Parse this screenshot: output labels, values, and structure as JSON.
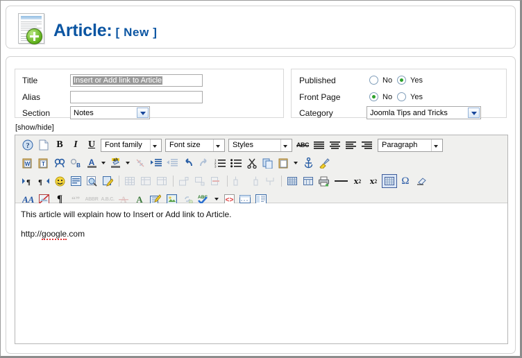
{
  "header": {
    "title_main": "Article:",
    "title_state": "[ New ]",
    "icon": "new-article-icon"
  },
  "form": {
    "left": [
      {
        "label": "Title",
        "type": "text",
        "value": "Insert or Add link to Article",
        "selected": true
      },
      {
        "label": "Alias",
        "type": "text",
        "value": "",
        "selected": false
      },
      {
        "label": "Section",
        "type": "select",
        "value": "Notes"
      }
    ],
    "right": [
      {
        "label": "Published",
        "type": "radio",
        "options": [
          "No",
          "Yes"
        ],
        "selected": "Yes"
      },
      {
        "label": "Front Page",
        "type": "radio",
        "options": [
          "No",
          "Yes"
        ],
        "selected": "No"
      },
      {
        "label": "Category",
        "type": "select",
        "value": "Joomla Tips and Tricks"
      }
    ]
  },
  "editor": {
    "showhide_label": "[show/hide]",
    "font_family_label": "Font family",
    "font_size_label": "Font size",
    "styles_label": "Styles",
    "paragraph_label": "Paragraph",
    "toolbar_rows": [
      [
        "help-icon",
        "new-document-icon",
        "bold-icon",
        "italic-icon",
        "underline-icon",
        "font-family-select",
        "font-size-select",
        "styles-select",
        "strikethrough-icon",
        "align-left-icon",
        "align-center-icon",
        "align-right-icon",
        "align-justify-icon",
        "paragraph-format-select"
      ],
      [
        "paste-from-word-icon",
        "paste-as-text-icon",
        "find-icon",
        "find-replace-icon",
        "text-color-icon",
        "background-color-icon",
        "unlink-icon",
        "indent-icon",
        "outdent-icon",
        "undo-icon",
        "redo-icon",
        "numbered-list-icon",
        "bullet-list-icon",
        "cut-icon",
        "copy-icon",
        "paste-icon",
        "anchor-icon",
        "cleanup-icon"
      ],
      [
        "ltr-icon",
        "rtl-icon",
        "emoticon-icon",
        "insert-media-icon",
        "preview-icon",
        "edit-html-icon",
        "insert-table-icon",
        "table-properties-icon",
        "delete-table-icon",
        "insert-row-before-icon",
        "insert-row-after-icon",
        "delete-row-icon",
        "split-cells-icon",
        "insert-column-before-icon",
        "insert-column-after-icon",
        "delete-column-icon",
        "merge-cells-icon",
        "table-grid-icon",
        "print-icon",
        "horizontal-rule-icon",
        "subscript-icon",
        "superscript-icon",
        "insert-table-active-icon",
        "special-character-icon",
        "eraser-icon"
      ],
      [
        "style-aa-icon",
        "no-image-icon",
        "pilcrow-icon",
        "blockquote-icon",
        "abbr-icon",
        "acronym-icon",
        "delete-text-icon",
        "insert-text-icon",
        "edit-page-icon",
        "insert-image-icon",
        "link-icon",
        "spellcheck-icon",
        "source-code-icon",
        "page-break-icon",
        "template-icon"
      ]
    ],
    "content": {
      "line1": "This article will explain how to Insert or Add link to Article.",
      "line2_prefix": "http://",
      "line2_misspelled": "google",
      "line2_suffix": ".com"
    }
  },
  "colors": {
    "title": "#0b55a2",
    "radio_on": "#2ca02c",
    "panel_border": "#d2d2d2",
    "editor_bg": "#f0f0ee",
    "spell_underline": "#e03232"
  }
}
